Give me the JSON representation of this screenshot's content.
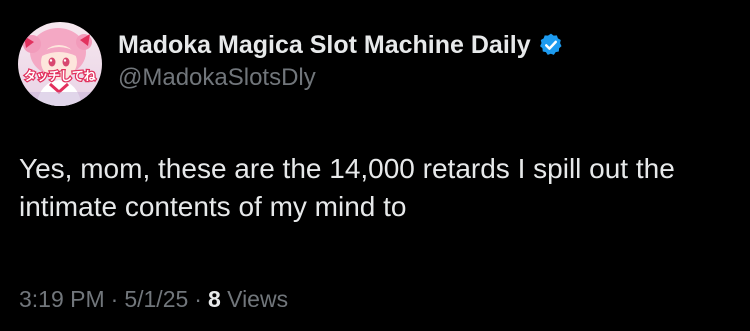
{
  "author": {
    "display_name": "Madoka Magica Slot Machine Daily",
    "handle": "@MadokaSlotsDly",
    "verified_icon": "verified-badge-icon",
    "avatar_icon": "anime-avatar-image",
    "avatar_text": "タッチしてね"
  },
  "tweet": {
    "text": "Yes, mom, these are the 14,000 retards I spill out the intimate contents of my mind to"
  },
  "meta": {
    "time": "3:19 PM",
    "separator": "·",
    "date": "5/1/25",
    "views_count": "8",
    "views_label": "Views"
  },
  "colors": {
    "background": "#000000",
    "primary_text": "#e7e9ea",
    "secondary_text": "#71767b",
    "verified_blue": "#1d9bf0"
  }
}
